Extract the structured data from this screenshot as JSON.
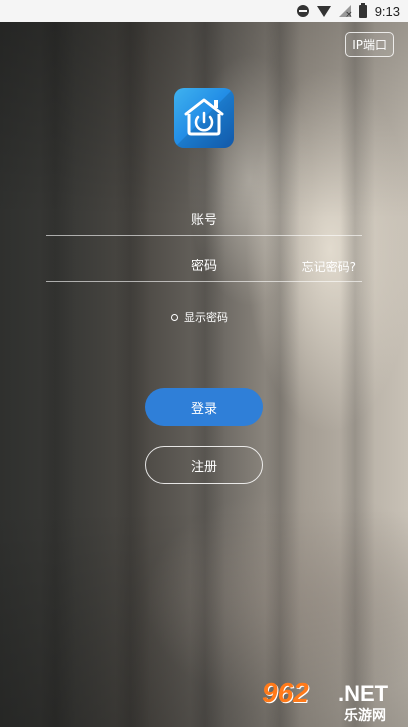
{
  "status_bar": {
    "time": "9:13",
    "icons": [
      "do-not-disturb-icon",
      "wifi-icon",
      "no-signal-icon",
      "battery-icon"
    ]
  },
  "header": {
    "ip_port_label": "IP端口"
  },
  "logo": {
    "icon": "home-power-icon",
    "colors": [
      "#3fb2ef",
      "#1565c0"
    ]
  },
  "form": {
    "account_placeholder": "账号",
    "password_placeholder": "密码",
    "forgot_password_label": "忘记密码?",
    "show_password_label": "显示密码",
    "login_label": "登录",
    "register_label": "注册"
  },
  "watermark": {
    "number": "962",
    "net": ".NET",
    "sub": "乐游网"
  },
  "colors": {
    "primary": "#2f7fd8"
  }
}
